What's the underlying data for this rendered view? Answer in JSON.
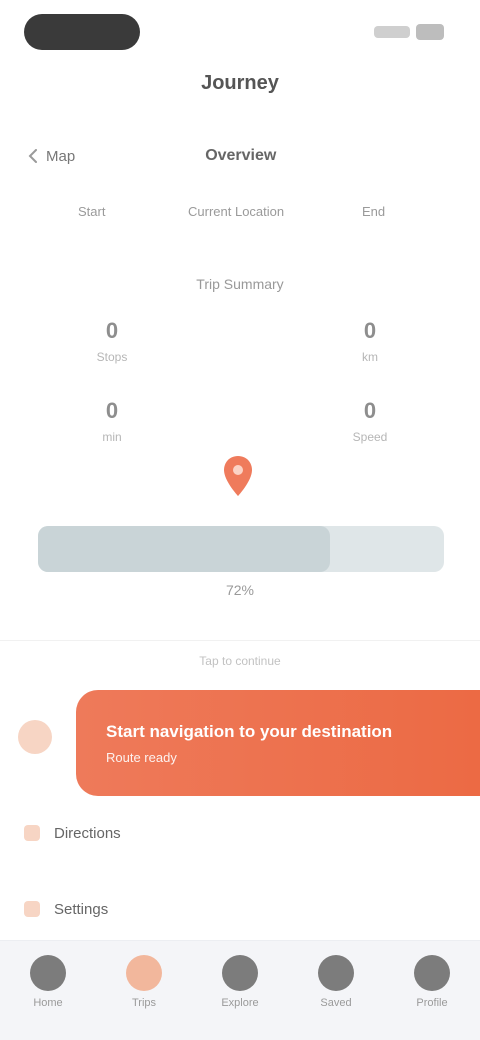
{
  "header": {
    "title": "Journey"
  },
  "tabs": {
    "back_label": "Map",
    "active_label": "Overview"
  },
  "labels": {
    "left": "Start",
    "center": "Current Location",
    "right": "End"
  },
  "sub_title": "Trip Summary",
  "stats": [
    {
      "value": "0",
      "caption": "Stops"
    },
    {
      "value": "0",
      "caption": "km"
    },
    {
      "value": "0",
      "caption": "min"
    },
    {
      "value": "0",
      "caption": "Speed"
    }
  ],
  "progress": {
    "value": 0.72,
    "label": "72%"
  },
  "hint": "Tap to continue",
  "cta": {
    "title": "Start navigation to your destination",
    "subtitle": "Route ready"
  },
  "list": [
    {
      "label": "Directions"
    },
    {
      "label": "Settings"
    }
  ],
  "nav": [
    {
      "label": "Home"
    },
    {
      "label": "Trips"
    },
    {
      "label": "Explore"
    },
    {
      "label": "Saved"
    },
    {
      "label": "Profile"
    }
  ],
  "colors": {
    "accent": "#EC6A44",
    "accent_soft": "#F7D5C4",
    "track": "#DFE6E8"
  }
}
